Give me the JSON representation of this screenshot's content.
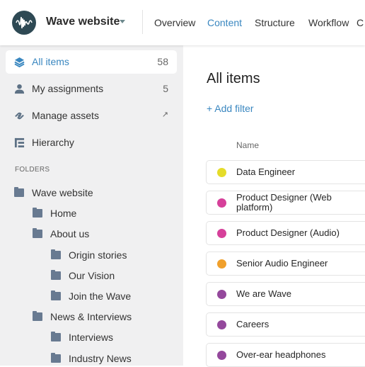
{
  "header": {
    "site_name": "Wave website",
    "tabs": [
      {
        "label": "Overview"
      },
      {
        "label": "Content",
        "active": true
      },
      {
        "label": "Structure"
      },
      {
        "label": "Workflow"
      },
      {
        "label": "C"
      }
    ],
    "accent": "#3a87c0"
  },
  "sidebar": {
    "nav": [
      {
        "label": "All items",
        "count": "58",
        "icon": "layers-icon",
        "active": true
      },
      {
        "label": "My assignments",
        "count": "5",
        "icon": "user-icon"
      },
      {
        "label": "Manage assets",
        "count": "↗",
        "icon": "link-icon"
      },
      {
        "label": "Hierarchy",
        "icon": "hierarchy-icon"
      }
    ],
    "folders_heading": "FOLDERS",
    "folders": [
      {
        "label": "Wave website",
        "level": 0
      },
      {
        "label": "Home",
        "level": 1
      },
      {
        "label": "About us",
        "level": 1
      },
      {
        "label": "Origin stories",
        "level": 2
      },
      {
        "label": "Our Vision",
        "level": 2
      },
      {
        "label": "Join the Wave",
        "level": 2
      },
      {
        "label": "News & Interviews",
        "level": 1
      },
      {
        "label": "Interviews",
        "level": 2
      },
      {
        "label": "Industry News",
        "level": 2
      }
    ]
  },
  "main": {
    "title": "All items",
    "add_filter": "+ Add filter",
    "column_name": "Name",
    "items": [
      {
        "name": "Data Engineer",
        "color": "#e5dc2a"
      },
      {
        "name": "Product Designer (Web platform)",
        "color": "#d6409a"
      },
      {
        "name": "Product Designer (Audio)",
        "color": "#d6409a"
      },
      {
        "name": "Senior Audio Engineer",
        "color": "#f0a02c"
      },
      {
        "name": "We are Wave",
        "color": "#94489c"
      },
      {
        "name": "Careers",
        "color": "#94489c"
      },
      {
        "name": "Over-ear headphones",
        "color": "#94489c"
      }
    ]
  }
}
